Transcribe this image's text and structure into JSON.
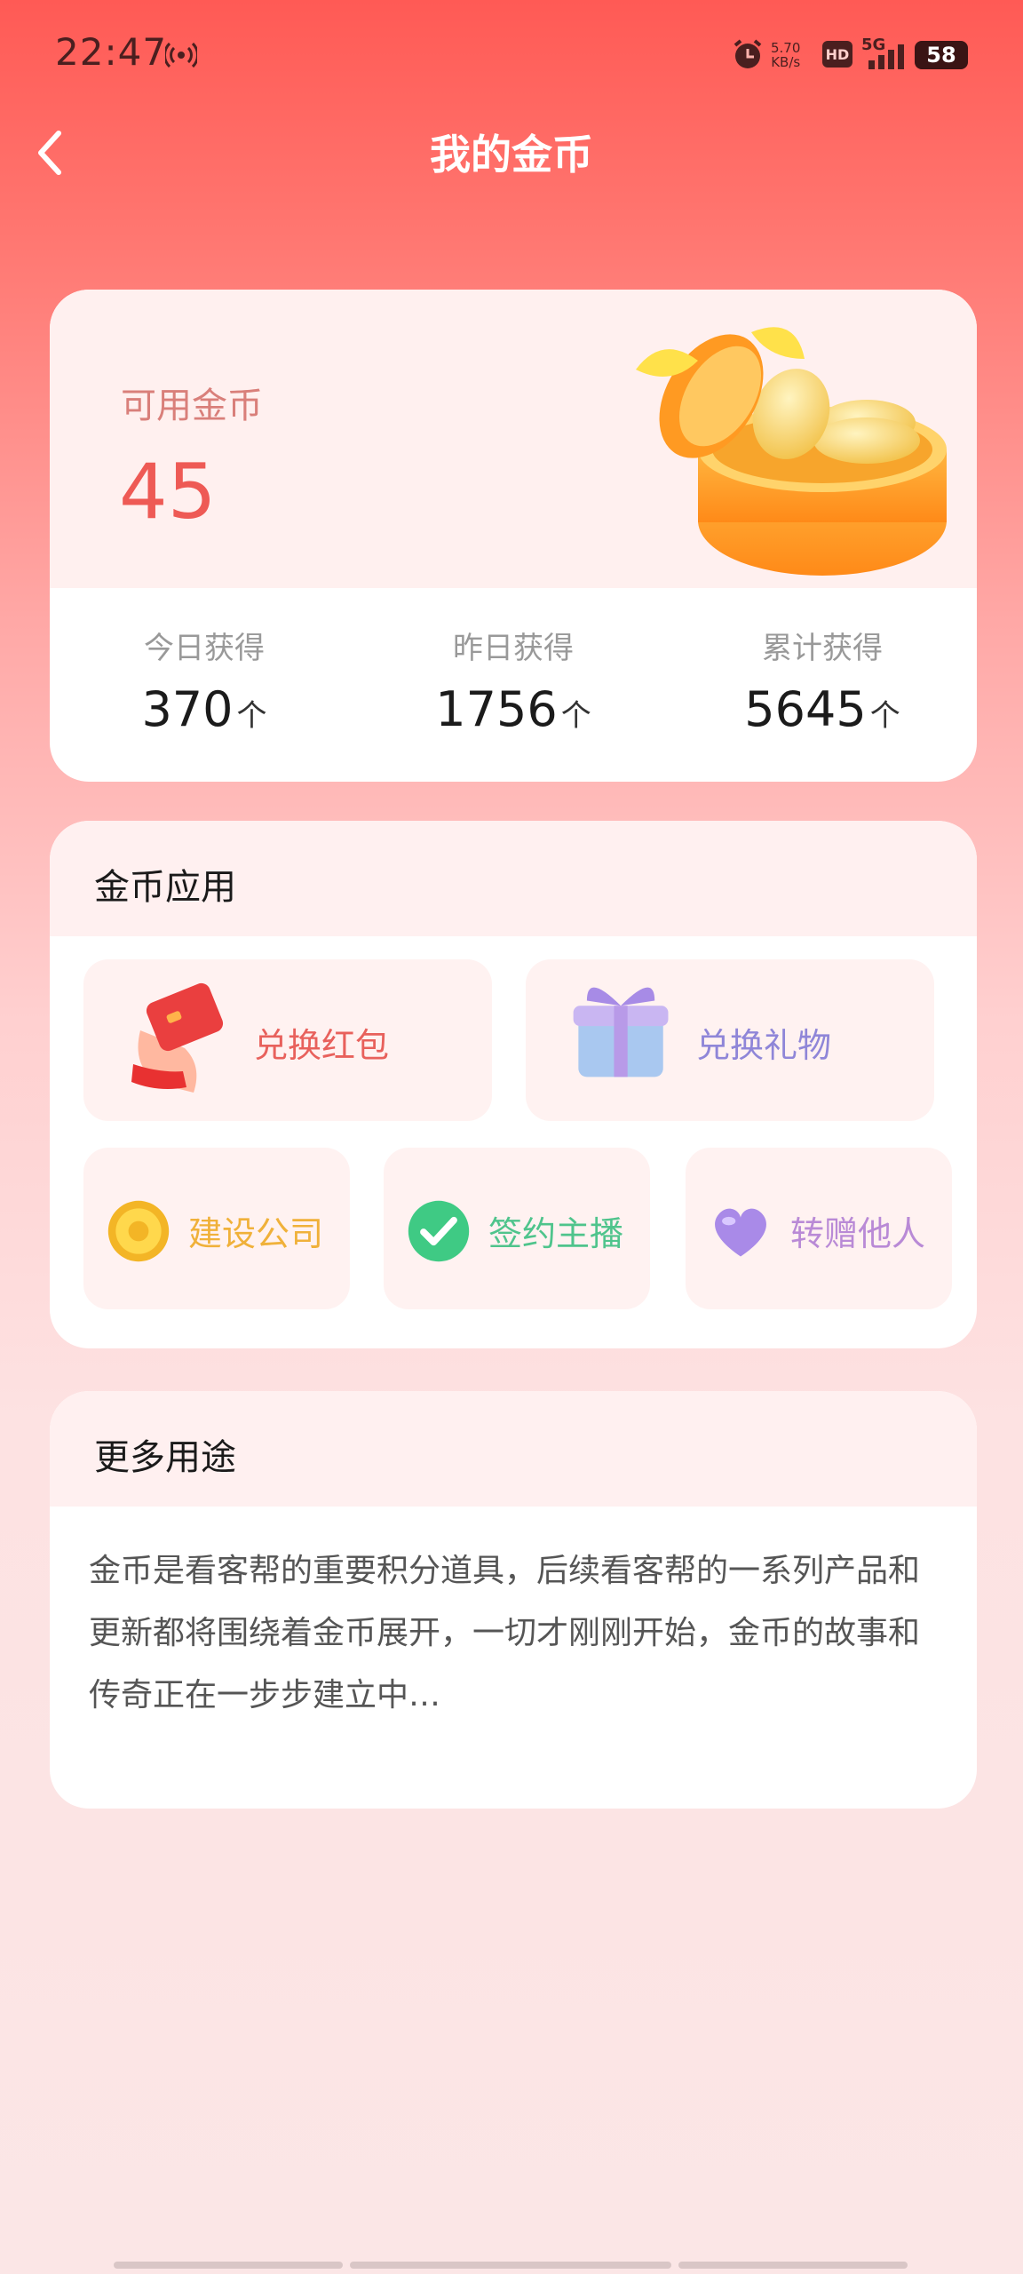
{
  "status_bar": {
    "time": "22:47",
    "net_speed_value": "5.70",
    "net_speed_unit": "KB/s",
    "hd": "HD",
    "network": "5G",
    "battery": "58"
  },
  "header": {
    "title": "我的金币"
  },
  "coins": {
    "available_label": "可用金币",
    "available_value": "45",
    "stats": [
      {
        "label": "今日获得",
        "value": "370",
        "unit": "个"
      },
      {
        "label": "昨日获得",
        "value": "1756",
        "unit": "个"
      },
      {
        "label": "累计获得",
        "value": "5645",
        "unit": "个"
      }
    ]
  },
  "apps": {
    "title": "金币应用",
    "items": [
      {
        "label": "兑换红包",
        "icon": "red-packet-icon",
        "color": "#e8615c"
      },
      {
        "label": "兑换礼物",
        "icon": "gift-icon",
        "color": "#8f86d8"
      },
      {
        "label": "建设公司",
        "icon": "gold-coin-icon",
        "color": "#f0b13a"
      },
      {
        "label": "签约主播",
        "icon": "check-circle-icon",
        "color": "#4fc48c"
      },
      {
        "label": "转赠他人",
        "icon": "heart-icon",
        "color": "#b98ad6"
      }
    ]
  },
  "more": {
    "title": "更多用途",
    "description": "金币是看客帮的重要积分道具，后续看客帮的一系列产品和更新都将围绕着金币展开，一切才刚刚开始，金币的故事和传奇正在一步步建立中…"
  }
}
